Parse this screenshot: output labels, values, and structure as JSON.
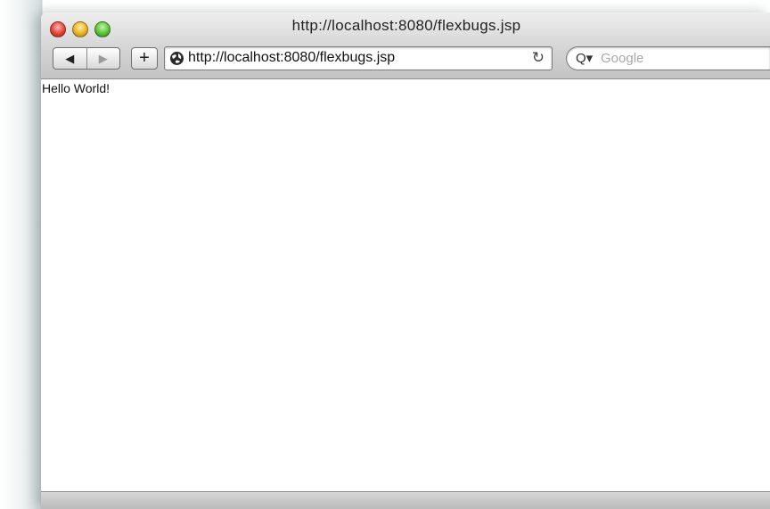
{
  "window": {
    "title": "http://localhost:8080/flexbugs.jsp"
  },
  "toolbar": {
    "back_symbol": "◀",
    "forward_symbol": "▶",
    "add_symbol": "+",
    "url": "http://localhost:8080/flexbugs.jsp",
    "reload_symbol": "↻",
    "search_icon_symbol": "Q▾",
    "search_placeholder": "Google"
  },
  "page": {
    "text": "Hello World!"
  },
  "icons": {
    "globe": "globe-icon",
    "reload": "reload-icon",
    "search": "search-icon"
  },
  "colors": {
    "close": "#e0443a",
    "minimize": "#e8b324",
    "zoom": "#5bc236"
  }
}
